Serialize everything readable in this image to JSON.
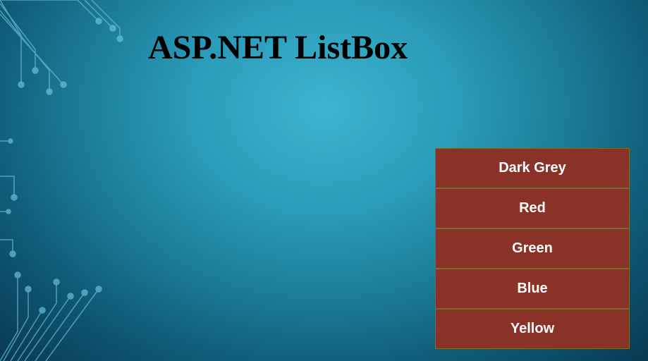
{
  "title": "ASP.NET ListBox",
  "listbox": {
    "items": [
      {
        "label": "Dark Grey"
      },
      {
        "label": "Red"
      },
      {
        "label": "Green"
      },
      {
        "label": "Blue"
      },
      {
        "label": "Yellow"
      }
    ]
  }
}
